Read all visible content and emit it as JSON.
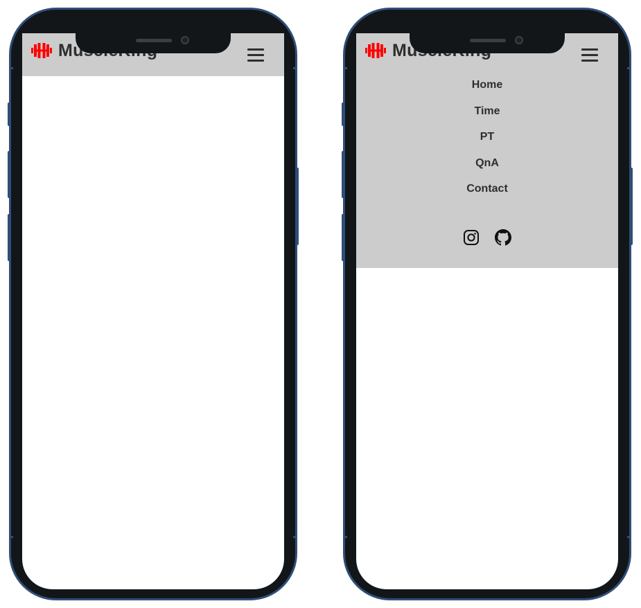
{
  "devices": [
    {
      "state": "menu-closed",
      "brand": {
        "name": "MuscleKing",
        "logo_icon": "dumbbell-icon"
      },
      "toggle_icon": "hamburger-icon"
    },
    {
      "state": "menu-open",
      "brand": {
        "name": "MuscleKing",
        "logo_icon": "dumbbell-icon"
      },
      "toggle_icon": "hamburger-icon",
      "menu": [
        {
          "label": "Home"
        },
        {
          "label": "Time"
        },
        {
          "label": "PT"
        },
        {
          "label": "QnA"
        },
        {
          "label": "Contact"
        }
      ],
      "socials": [
        {
          "icon": "instagram-icon"
        },
        {
          "icon": "github-icon"
        }
      ]
    }
  ],
  "colors": {
    "navbar_bg": "#cccccc",
    "brand_text": "#2e2e2e",
    "logo": "#ff0000",
    "phone_frame": "#121619",
    "phone_border": "#2f4e78"
  }
}
